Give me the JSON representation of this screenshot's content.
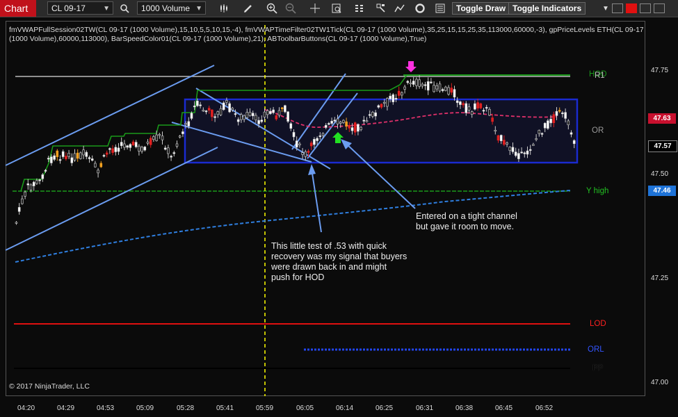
{
  "toolbar": {
    "chart_tab": "Chart",
    "instrument": "CL 09-17",
    "interval": "1000 Volume",
    "toggle_draw": "Toggle Draw",
    "toggle_indicators": "Toggle Indicators",
    "icons": [
      "search-icon",
      "bar-type-icon",
      "pencil-icon",
      "zoom-in-icon",
      "zoom-out-icon",
      "crosshair-icon",
      "properties-icon",
      "strategies-icon",
      "indicators-icon",
      "drawing-tools-icon",
      "refresh-icon",
      "data-box-icon"
    ]
  },
  "indicator_text": {
    "line1": "fmVWAPFullSession02TW(CL 09-17 (1000 Volume),15,10,5,5,10,15,-4), fmVWAPTimeFilter02TW1Tick(CL 09-17 (1000 Volume),35,25,15,15,25,35,113000,60000,-3), gpPriceLevels ETH(CL 09-17",
    "line2": "(1000 Volume),60000,113000), BarSpeedColor01(CL 09-17 (1000 Volume),21), ABToolbarButtons(CL 09-17 (1000 Volume),True)"
  },
  "price_axis": {
    "ticks": [
      "47.75",
      "47.50",
      "47.25",
      "47.00"
    ],
    "labels": [
      {
        "text": "47.63",
        "color": "#c8102e"
      },
      {
        "text": "47.57",
        "color": "#000000"
      },
      {
        "text": "47.46",
        "color": "#1e73d8"
      }
    ]
  },
  "time_axis": [
    "04:20",
    "04:29",
    "04:53",
    "05:09",
    "05:28",
    "05:41",
    "05:59",
    "06:05",
    "06:14",
    "06:25",
    "06:31",
    "06:38",
    "06:45",
    "06:52"
  ],
  "levels": {
    "hod": "HOD",
    "r1": "R1",
    "or": "OR",
    "y_high": "Y high",
    "lod": "LOD",
    "orl": "ORL",
    "pp": "PP"
  },
  "annotations": {
    "note1": "This little test of .53 with quick\nrecovery was my signal that buyers\nwere drawn back in and might\npush for HOD",
    "note2": "Entered on a tight channel\nbut gave it room to move."
  },
  "copyright": "© 2017 NinjaTrader, LLC",
  "colors": {
    "accent": "#c0111b",
    "hod": "#1a9a1a",
    "lod": "#e01010",
    "orl": "#2244ee",
    "vwap": "#2f7fe0",
    "box": "#1a2bd0"
  }
}
